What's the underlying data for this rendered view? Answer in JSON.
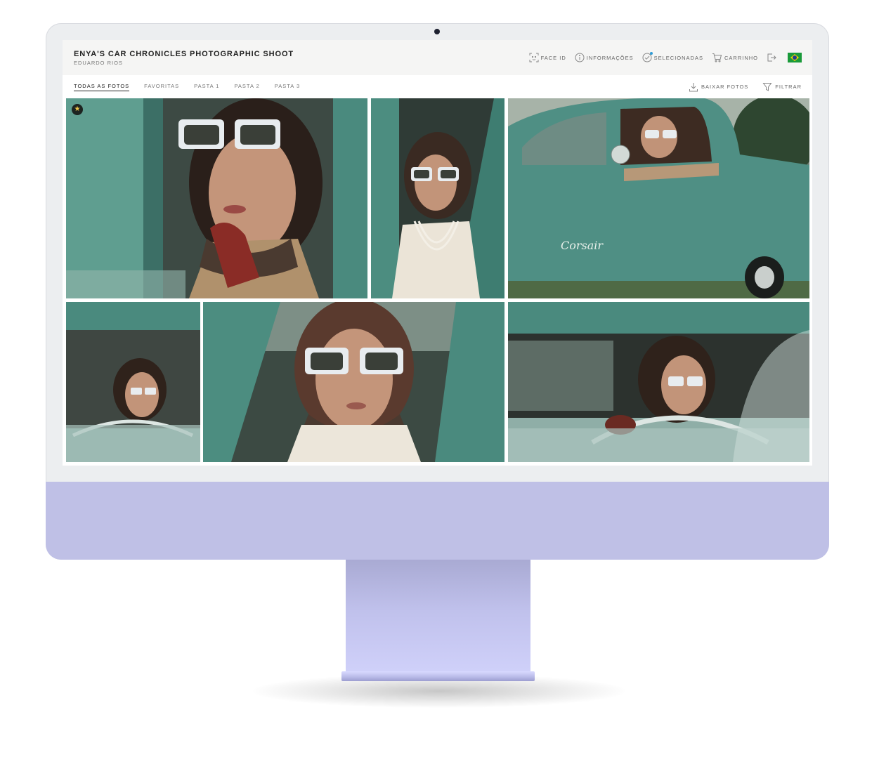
{
  "gallery": {
    "title": "ENYA'S CAR CHRONICLES PHOTOGRAPHIC SHOOT",
    "photographer": "EDUARDO RIOS"
  },
  "header_actions": [
    {
      "id": "face-id",
      "label": "FACE ID",
      "icon": "face-scan-icon"
    },
    {
      "id": "info",
      "label": "INFORMAÇÕES",
      "icon": "info-icon"
    },
    {
      "id": "selected",
      "label": "SELECIONADAS",
      "icon": "check-circle-icon"
    },
    {
      "id": "cart",
      "label": "CARRINHO",
      "icon": "cart-icon"
    },
    {
      "id": "logout",
      "label": "",
      "icon": "logout-icon"
    },
    {
      "id": "language",
      "label": "",
      "icon": "brazil-flag-icon"
    }
  ],
  "tabs": [
    {
      "label": "TODAS AS FOTOS",
      "active": true
    },
    {
      "label": "FAVORITAS",
      "active": false
    },
    {
      "label": "PASTA 1",
      "active": false
    },
    {
      "label": "PASTA 2",
      "active": false
    },
    {
      "label": "PASTA 3",
      "active": false
    }
  ],
  "tools": {
    "download_label": "BAIXAR FOTOS",
    "filter_label": "FILTRAR"
  },
  "photos": [
    {
      "id": 1,
      "favorite": true,
      "alt": "woman in cat-eye sunglasses applying lipstick in a green car"
    },
    {
      "id": 2,
      "favorite": false,
      "alt": "woman with pearl necklace inside the car"
    },
    {
      "id": 3,
      "favorite": false,
      "alt": "woman leaning out of window of vintage green Corsair car"
    },
    {
      "id": 4,
      "favorite": false,
      "alt": "woman driving seen through windshield"
    },
    {
      "id": 5,
      "favorite": false,
      "alt": "close-up of woman in headscarf and sunglasses"
    },
    {
      "id": 6,
      "favorite": false,
      "alt": "woman holding steering wheel"
    }
  ],
  "car_badge_text": "Corsair",
  "colors": {
    "car_teal": "#4f8f84",
    "monitor_chin": "#bfc0e6",
    "accent_blue": "#2e9bd6",
    "favorite_star": "#e9c24a"
  }
}
